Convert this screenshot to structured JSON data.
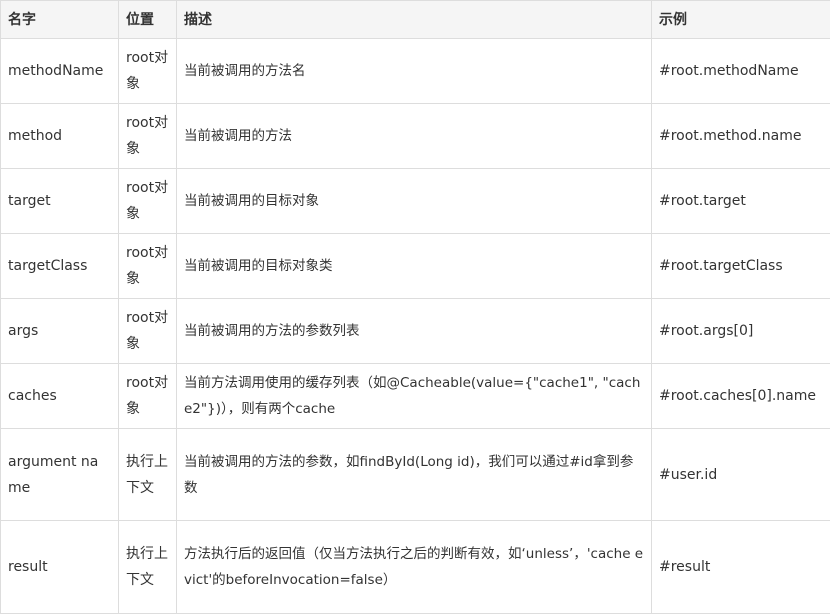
{
  "table": {
    "headers": [
      "名字",
      "位置",
      "描述",
      "示例"
    ],
    "rows": [
      {
        "name": "methodName",
        "location": "root对象",
        "description": "当前被调用的方法名",
        "example": "#root.methodName"
      },
      {
        "name": "method",
        "location": "root对象",
        "description": "当前被调用的方法",
        "example": "#root.method.name"
      },
      {
        "name": "target",
        "location": "root对象",
        "description": "当前被调用的目标对象",
        "example": "#root.target"
      },
      {
        "name": "targetClass",
        "location": "root对象",
        "description": "当前被调用的目标对象类",
        "example": "#root.targetClass"
      },
      {
        "name": "args",
        "location": "root对象",
        "description": "当前被调用的方法的参数列表",
        "example": "#root.args[0]"
      },
      {
        "name": "caches",
        "location": "root对象",
        "description": "当前方法调用使用的缓存列表（如@Cacheable(value={\"cache1\", \"cache2\"})），则有两个cache",
        "example": "#root.caches[0].name"
      },
      {
        "name": "argument name",
        "location": "执行上下文",
        "description": "当前被调用的方法的参数，如findById(Long id)，我们可以通过#id拿到参数",
        "example": "#user.id"
      },
      {
        "name": "result",
        "location": "执行上下文",
        "description": "方法执行后的返回值（仅当方法执行之后的判断有效，如‘unless’，'cache evict'的beforeInvocation=false）",
        "example": "#result"
      }
    ]
  }
}
